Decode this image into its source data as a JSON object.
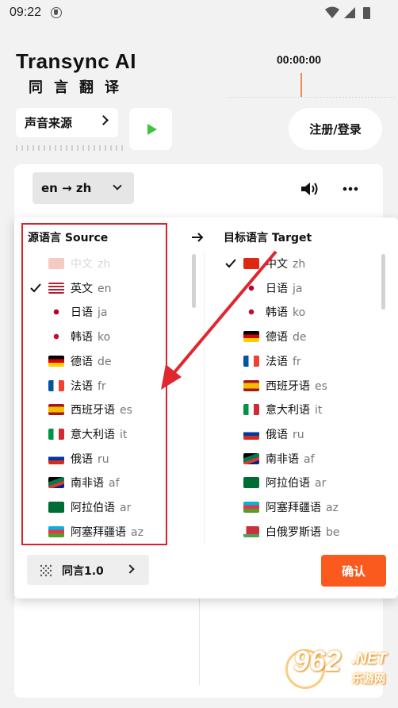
{
  "status": {
    "time": "09:22"
  },
  "header": {
    "title": "Transync AI",
    "subtitle": "同言翻译",
    "timer": "00:00:00"
  },
  "controls": {
    "source_label": "声音来源",
    "login_label": "注册/登录"
  },
  "main": {
    "lang_pair": "en → zh"
  },
  "popup": {
    "source_title": "源语言 Source",
    "target_title": "目标语言 Target",
    "source_items": [
      {
        "name": "中文",
        "code": "zh",
        "flag": "cn",
        "state": "disabled"
      },
      {
        "name": "英文",
        "code": "en",
        "flag": "us",
        "state": "selected"
      },
      {
        "name": "日语",
        "code": "ja",
        "flag": "jp",
        "state": "normal"
      },
      {
        "name": "韩语",
        "code": "ko",
        "flag": "kr",
        "state": "normal"
      },
      {
        "name": "德语",
        "code": "de",
        "flag": "de",
        "state": "normal"
      },
      {
        "name": "法语",
        "code": "fr",
        "flag": "fr",
        "state": "normal"
      },
      {
        "name": "西班牙语",
        "code": "es",
        "flag": "es",
        "state": "normal"
      },
      {
        "name": "意大利语",
        "code": "it",
        "flag": "it",
        "state": "normal"
      },
      {
        "name": "俄语",
        "code": "ru",
        "flag": "ru",
        "state": "normal"
      },
      {
        "name": "南非语",
        "code": "af",
        "flag": "za",
        "state": "normal"
      },
      {
        "name": "阿拉伯语",
        "code": "ar",
        "flag": "sa",
        "state": "normal"
      },
      {
        "name": "阿塞拜疆语",
        "code": "az",
        "flag": "az",
        "state": "normal"
      }
    ],
    "target_items": [
      {
        "name": "中文",
        "code": "zh",
        "flag": "cn",
        "state": "selected"
      },
      {
        "name": "日语",
        "code": "ja",
        "flag": "jp",
        "state": "normal"
      },
      {
        "name": "韩语",
        "code": "ko",
        "flag": "kr",
        "state": "normal"
      },
      {
        "name": "德语",
        "code": "de",
        "flag": "de",
        "state": "normal"
      },
      {
        "name": "法语",
        "code": "fr",
        "flag": "fr",
        "state": "normal"
      },
      {
        "name": "西班牙语",
        "code": "es",
        "flag": "es",
        "state": "normal"
      },
      {
        "name": "意大利语",
        "code": "it",
        "flag": "it",
        "state": "normal"
      },
      {
        "name": "俄语",
        "code": "ru",
        "flag": "ru",
        "state": "normal"
      },
      {
        "name": "南非语",
        "code": "af",
        "flag": "za",
        "state": "normal"
      },
      {
        "name": "阿拉伯语",
        "code": "ar",
        "flag": "sa",
        "state": "normal"
      },
      {
        "name": "阿塞拜疆语",
        "code": "az",
        "flag": "az",
        "state": "normal"
      },
      {
        "name": "白俄罗斯语",
        "code": "be",
        "flag": "by",
        "state": "normal"
      }
    ],
    "model_label": "同言1.0",
    "confirm_label": "确认"
  },
  "watermark": {
    "number": "962",
    "domain": ".NET",
    "site": "乐游网"
  },
  "colors": {
    "accent": "#fb5a1f",
    "highlight": "#d7222b",
    "play": "#3fc33f"
  }
}
